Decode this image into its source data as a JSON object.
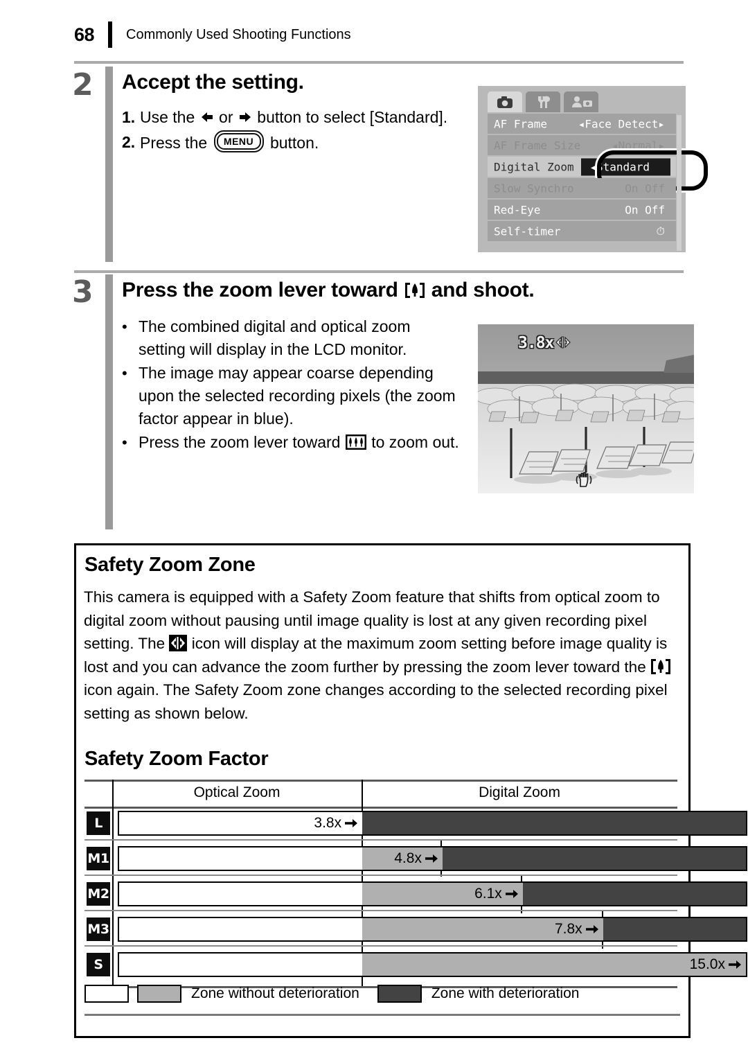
{
  "header": {
    "page_number": "68",
    "chapter": "Commonly Used Shooting Functions"
  },
  "step2": {
    "number": "2",
    "heading": "Accept the setting.",
    "items": [
      {
        "mark": "1.",
        "text_before": "Use the",
        "text_mid": "or",
        "text_after": "button to select [Standard]."
      },
      {
        "mark": "2.",
        "text_before": "Press the",
        "text_after": "button."
      }
    ]
  },
  "camera_menu": {
    "tabs": [
      "camera-tab",
      "wrench-tab",
      "mypage-tab"
    ],
    "rows": [
      {
        "label": "AF Frame",
        "value": "Face Detect",
        "state": "normal",
        "arrows": true
      },
      {
        "label": "AF Frame Size",
        "value": "Normal",
        "state": "dim",
        "arrows": true
      },
      {
        "label": "Digital Zoom",
        "value": "Standard",
        "state": "selected",
        "arrows": true
      },
      {
        "label": "Slow Synchro",
        "value": "On Off",
        "state": "dim",
        "arrows": false
      },
      {
        "label": "Red-Eye",
        "value": "On Off",
        "state": "normal",
        "arrows": false
      },
      {
        "label": "Self-timer",
        "value": "self-timer-icon",
        "state": "normal",
        "arrows": false
      }
    ]
  },
  "step3": {
    "number": "3",
    "heading_before": "Press the zoom lever toward",
    "heading_after": "and shoot.",
    "bullets": [
      {
        "text": "The combined digital and optical zoom setting will display in the LCD monitor."
      },
      {
        "text": "The image may appear coarse depending upon the selected recording pixels (the zoom factor appear in blue)."
      },
      {
        "text_before": "Press the zoom lever toward",
        "text_after": "to zoom out."
      }
    ]
  },
  "photo": {
    "zoom_label": "3.8x",
    "overlay_icon": "safety-zoom-icon",
    "hand_icon": "camera-shake-warning-icon"
  },
  "safety_zone": {
    "title": "Safety Zoom Zone",
    "paragraph_1": "This camera is equipped with a Safety Zoom feature that shifts from optical zoom to digital zoom without pausing until image quality is lost at any given recording pixel setting. The",
    "paragraph_2": "icon will display at the maximum zoom setting before image quality is lost and you can advance the zoom further by pressing the zoom lever toward the",
    "paragraph_3": "icon again. The Safety Zoom zone changes according to the selected recording pixel setting as shown below.",
    "factor_title": "Safety Zoom Factor"
  },
  "chart_data": {
    "type": "bar",
    "title": "Safety Zoom Factor",
    "column_headers": [
      "Optical Zoom",
      "Digital Zoom"
    ],
    "categories": [
      "L",
      "M1",
      "M2",
      "M3",
      "S"
    ],
    "series": [
      {
        "name": "Zone without deterioration",
        "color": "#b0b0b0"
      },
      {
        "name": "Zone with deterioration",
        "color": "#434343"
      }
    ],
    "values": [
      "3.8x",
      "4.8x",
      "6.1x",
      "7.8x",
      "15.0x"
    ],
    "rows": [
      {
        "label": "L",
        "value": "3.8x",
        "optical_end_pct": 26.8,
        "safe_end_pct": 26.8
      },
      {
        "label": "M1",
        "value": "4.8x",
        "optical_end_pct": 26.8,
        "safe_end_pct": 41.5
      },
      {
        "label": "M2",
        "value": "6.1x",
        "optical_end_pct": 26.8,
        "safe_end_pct": 55.7
      },
      {
        "label": "M3",
        "value": "7.8x",
        "optical_end_pct": 26.8,
        "safe_end_pct": 69.8
      },
      {
        "label": "S",
        "value": "15.0x",
        "optical_end_pct": 26.8,
        "safe_end_pct": 100
      }
    ],
    "legend": [
      {
        "swatches": [
          "white",
          "gray"
        ],
        "label": "Zone without deterioration"
      },
      {
        "swatches": [
          "dark"
        ],
        "label": "Zone with deterioration"
      }
    ],
    "xlabel": "",
    "ylabel": "",
    "grid": true,
    "legend_position": "bottom"
  }
}
